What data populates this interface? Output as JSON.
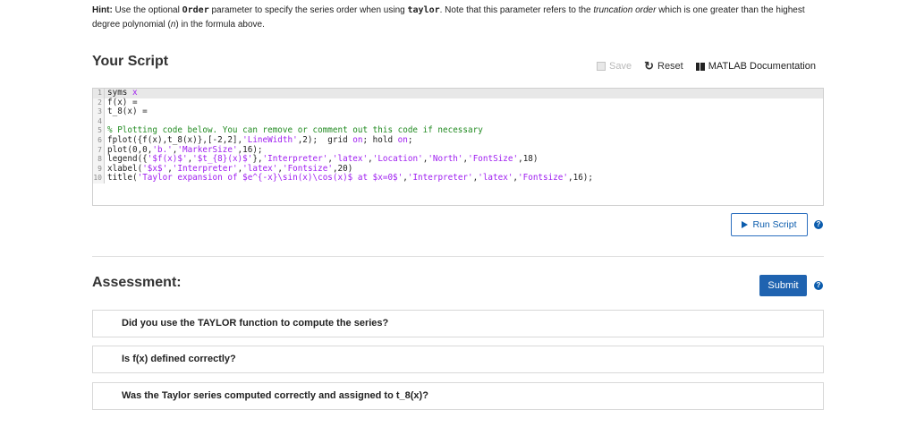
{
  "hint": {
    "label": "Hint:",
    "text_1": " Use the optional ",
    "code_1": "Order",
    "text_2": " parameter to specify the series order when using ",
    "code_2": "taylor",
    "text_3": ". Note that this parameter refers to the ",
    "italic_1": "truncation order",
    "text_4": " which is one greater than the highest degree polynomial (",
    "italic_2": "n",
    "text_5": ") in the formula above."
  },
  "script": {
    "title": "Your Script",
    "toolbar": {
      "save_label": "Save",
      "reset_label": "Reset",
      "doc_label": "MATLAB Documentation"
    }
  },
  "editor": {
    "lines": [
      {
        "num": "1"
      },
      {
        "num": "2"
      },
      {
        "num": "3"
      },
      {
        "num": "4"
      },
      {
        "num": "5"
      },
      {
        "num": "6"
      },
      {
        "num": "7"
      },
      {
        "num": "8"
      },
      {
        "num": "9"
      },
      {
        "num": "10"
      }
    ],
    "l1_a": "syms ",
    "l1_b": "x",
    "l2_a": "f(x) =",
    "l3_a": "t_8(x) =",
    "l5_a": "% Plotting code below. You can remove or comment out this code if necessary",
    "l6_a": "fplot({f(x),t_8(x)},[-2,2],",
    "l6_b": "'LineWidth'",
    "l6_c": ",2);  grid ",
    "l6_d": "on",
    "l6_e": "; hold ",
    "l6_f": "on",
    "l6_g": ";",
    "l7_a": "plot(0,0,",
    "l7_b": "'b.'",
    "l7_c": ",",
    "l7_d": "'MarkerSize'",
    "l7_e": ",16);",
    "l8_a": "legend({",
    "l8_b": "'$f(x)$'",
    "l8_c": ",",
    "l8_d": "'$t_{8}(x)$'",
    "l8_e": "},",
    "l8_f": "'Interpreter'",
    "l8_g": ",",
    "l8_h": "'latex'",
    "l8_i": ",",
    "l8_j": "'Location'",
    "l8_k": ",",
    "l8_l": "'North'",
    "l8_m": ",",
    "l8_n": "'FontSize'",
    "l8_o": ",18)",
    "l9_a": "xlabel(",
    "l9_b": "'$x$'",
    "l9_c": ",",
    "l9_d": "'Interpreter'",
    "l9_e": ",",
    "l9_f": "'latex'",
    "l9_g": ",",
    "l9_h": "'Fontsize'",
    "l9_i": ",20)",
    "l10_a": "title(",
    "l10_b": "'Taylor expansion of $e^{-x}\\sin(x)\\cos(x)$ at $x=0$'",
    "l10_c": ",",
    "l10_d": "'Interpreter'",
    "l10_e": ",",
    "l10_f": "'latex'",
    "l10_g": ",",
    "l10_h": "'Fontsize'",
    "l10_i": ",16);"
  },
  "run_label": "Run Script",
  "help_glyph": "?",
  "assessment": {
    "title": "Assessment:",
    "submit_label": "Submit",
    "items": [
      {
        "text": "Did you use the TAYLOR function to compute the series?"
      },
      {
        "text": "Is f(x) defined correctly?"
      },
      {
        "text": "Was the Taylor series computed correctly and assigned to t_8(x)?"
      }
    ]
  },
  "colors": {
    "accent": "#1f63b0",
    "string": "#a020f0",
    "comment": "#228b22",
    "keyword": "#0000ff"
  }
}
